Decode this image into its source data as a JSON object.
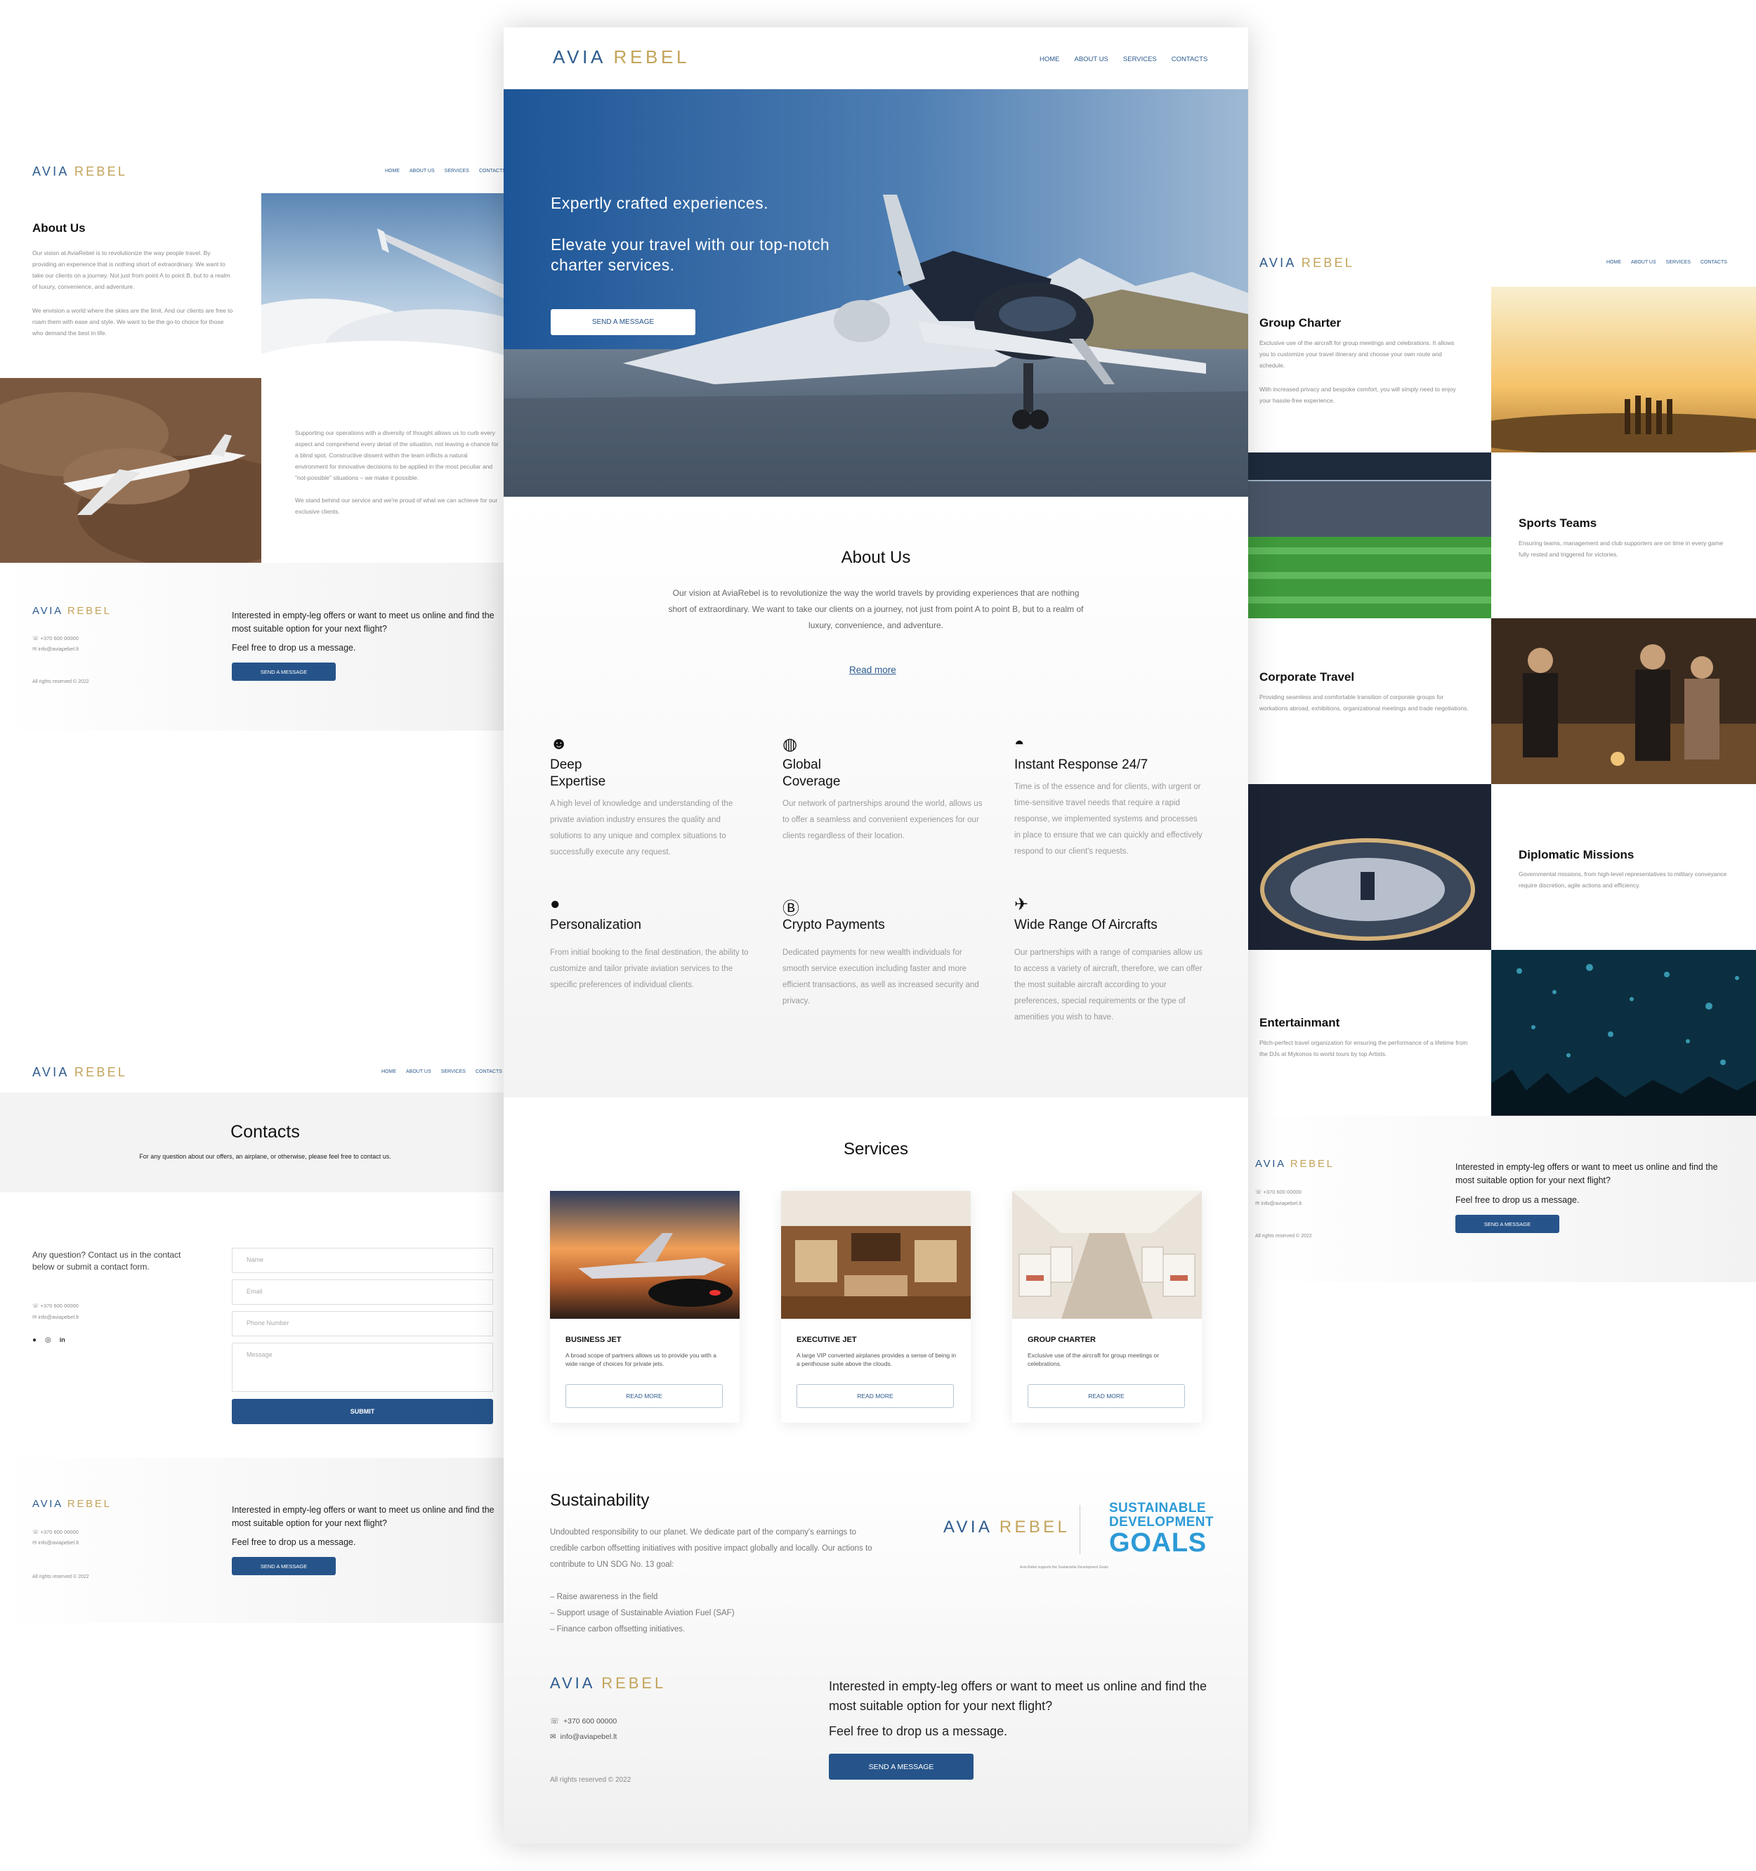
{
  "logo": {
    "part1": "AVIA",
    "part2": "REBEL"
  },
  "nav": {
    "home": "HOME",
    "about": "ABOUT US",
    "services": "SERVICES",
    "contacts": "CONTACTS"
  },
  "hero": {
    "line1": "Expertly crafted experiences.",
    "line2": "Elevate your travel with our top-notch charter services.",
    "button": "SEND A MESSAGE"
  },
  "about": {
    "title": "About Us",
    "text": "Our vision at AviaRebel is to revolutionize the way the world travels by providing experiences that are nothing short of extraordinary. We want to take our clients on a journey, not just from point A to point B, but to a realm of luxury, convenience, and adventure.",
    "read_more": "Read more"
  },
  "features": [
    {
      "icon": "brain-icon",
      "title": "Deep Expertise",
      "text": "A high level of knowledge and understanding of the private aviation industry ensures the quality and solutions to any unique and complex situations to successfully execute any request."
    },
    {
      "icon": "globe-icon",
      "title": "Global Coverage",
      "text": "Our network of partnerships around the world, allows us to offer a seamless and convenient experiences for our clients regardless of their location."
    },
    {
      "icon": "headset-icon",
      "title": "Instant Response 24/7",
      "text": "Time is of the essence and for clients, with urgent or time-sensitive travel needs that require a rapid response, we implemented systems and processes in place to ensure that we can quickly and effectively respond to our client's requests."
    },
    {
      "icon": "user-icon",
      "title": "Personalization",
      "text": "From initial booking to the final destination, the ability to customize and tailor private aviation services to the specific preferences of individual clients."
    },
    {
      "icon": "bitcoin-icon",
      "title": "Crypto Payments",
      "text": "Dedicated payments for new wealth individuals for smooth service execution including faster and more efficient transactions, as well as increased security and privacy."
    },
    {
      "icon": "airplane-icon",
      "title": "Wide Range Of Aircrafts",
      "text": "Our partnerships with a range of companies allow us to access a variety of aircraft, therefore, we can offer the most suitable aircraft according to your preferences, special requirements or the type of amenities you wish to have."
    }
  ],
  "services": {
    "title": "Services",
    "cards": [
      {
        "title": "BUSINESS JET",
        "text": "A broad scope of partners allows us to provide you with a wide range of choices for private jets.",
        "button": "READ MORE"
      },
      {
        "title": "EXECUTIVE JET",
        "text": "A large VIP converted airplanes provides a sense of being in a penthouse suite above the clouds.",
        "button": "READ MORE"
      },
      {
        "title": "GROUP CHARTER",
        "text": "Exclusive use of the aircraft for group meetings or celebrations.",
        "button": "READ MORE"
      }
    ]
  },
  "sustainability": {
    "title": "Sustainability",
    "text": "Undoubted responsibility to our planet. We dedicate part of the company's earnings to credible carbon offsetting initiatives with positive impact globally and locally. Our actions to contribute to UN SDG No. 13 goal:",
    "bullets": [
      "– Raise awareness in the field",
      "– Support usage of Sustainable Aviation Fuel (SAF)",
      "– Finance carbon offsetting initiatives."
    ],
    "sdg_line1": "SUSTAINABLE",
    "sdg_line2": "DEVELOPMENT",
    "sdg_line3": "GOALS",
    "caption": "Avia Rebel supports the Sustainable Development Goals"
  },
  "footer": {
    "phone": "+370 600 00000",
    "email": "info@aviapebel.lt",
    "rights": "All rights reserved © 2022",
    "cta1": "Interested in empty-leg offers or want to meet us online and find the most suitable option for your next flight?",
    "cta2": "Feel free to drop us a message.",
    "button": "SEND A MESSAGE"
  },
  "about_page": {
    "title": "About Us",
    "p1": "Our vision at AviaRebel is to revolutionize the way people travel. By providing an experience that is nothing short of extraordinary. We want to take our clients on a journey. Not just from point A to point B, but to a realm of luxury, convenience, and adventure.",
    "p2": "We envision a world where the skies are the limit. And our clients are free to roam them with ease and style. We want to be the go-to choice for those who demand the best in life.",
    "p3": "Supporting our operations with a diversity of thought allows us to curb every aspect and comprehend every detail of the situation, not leaving a chance for a blind spot. Constructive dissent within the team inflicts a natural environment for innovative decisions to be applied in the most peculiar and \"not-possible\" situations – we make it possible.",
    "p4": "We stand behind our service and we're proud of what we can achieve for our exclusive clients."
  },
  "contacts_page": {
    "title": "Contacts",
    "subtitle": "For any question about our offers, an airplane, or otherwise, please feel free to contact us.",
    "side": "Any question? Contact us in the contact below or submit a contact form.",
    "name_ph": "Name",
    "email_ph": "Email",
    "phone_ph": "Phone Number",
    "message_ph": "Message",
    "submit": "SUBMIT"
  },
  "services_page": [
    {
      "title": "Group Charter",
      "p1": "Exclusive use of the aircraft for group meetings and celebrations. It allows you to customize your travel itinerary and choose your own route and schedule.",
      "p2": "With increased privacy and bespoke comfort, you will simply need to enjoy your hassle-free experience."
    },
    {
      "title": "Sports Teams",
      "p1": "Ensuring teams, management and club supporters are on time in every game fully rested and triggered for victories.",
      "p2": ""
    },
    {
      "title": "Corporate Travel",
      "p1": "Providing seamless and comfortable transition of corporate groups for workations abroad, exhibitions, organizational meetings and trade negotiations.",
      "p2": ""
    },
    {
      "title": "Diplomatic Missions",
      "p1": "Governmental missions, from high-level representatives to military conveyance require discretion, agile actions and efficiency.",
      "p2": ""
    },
    {
      "title": "Entertainmant",
      "p1": "Pitch-perfect travel organization for ensuring the performance of a lifetime from the DJs at Mykonos to world tours by top Artists.",
      "p2": ""
    }
  ]
}
